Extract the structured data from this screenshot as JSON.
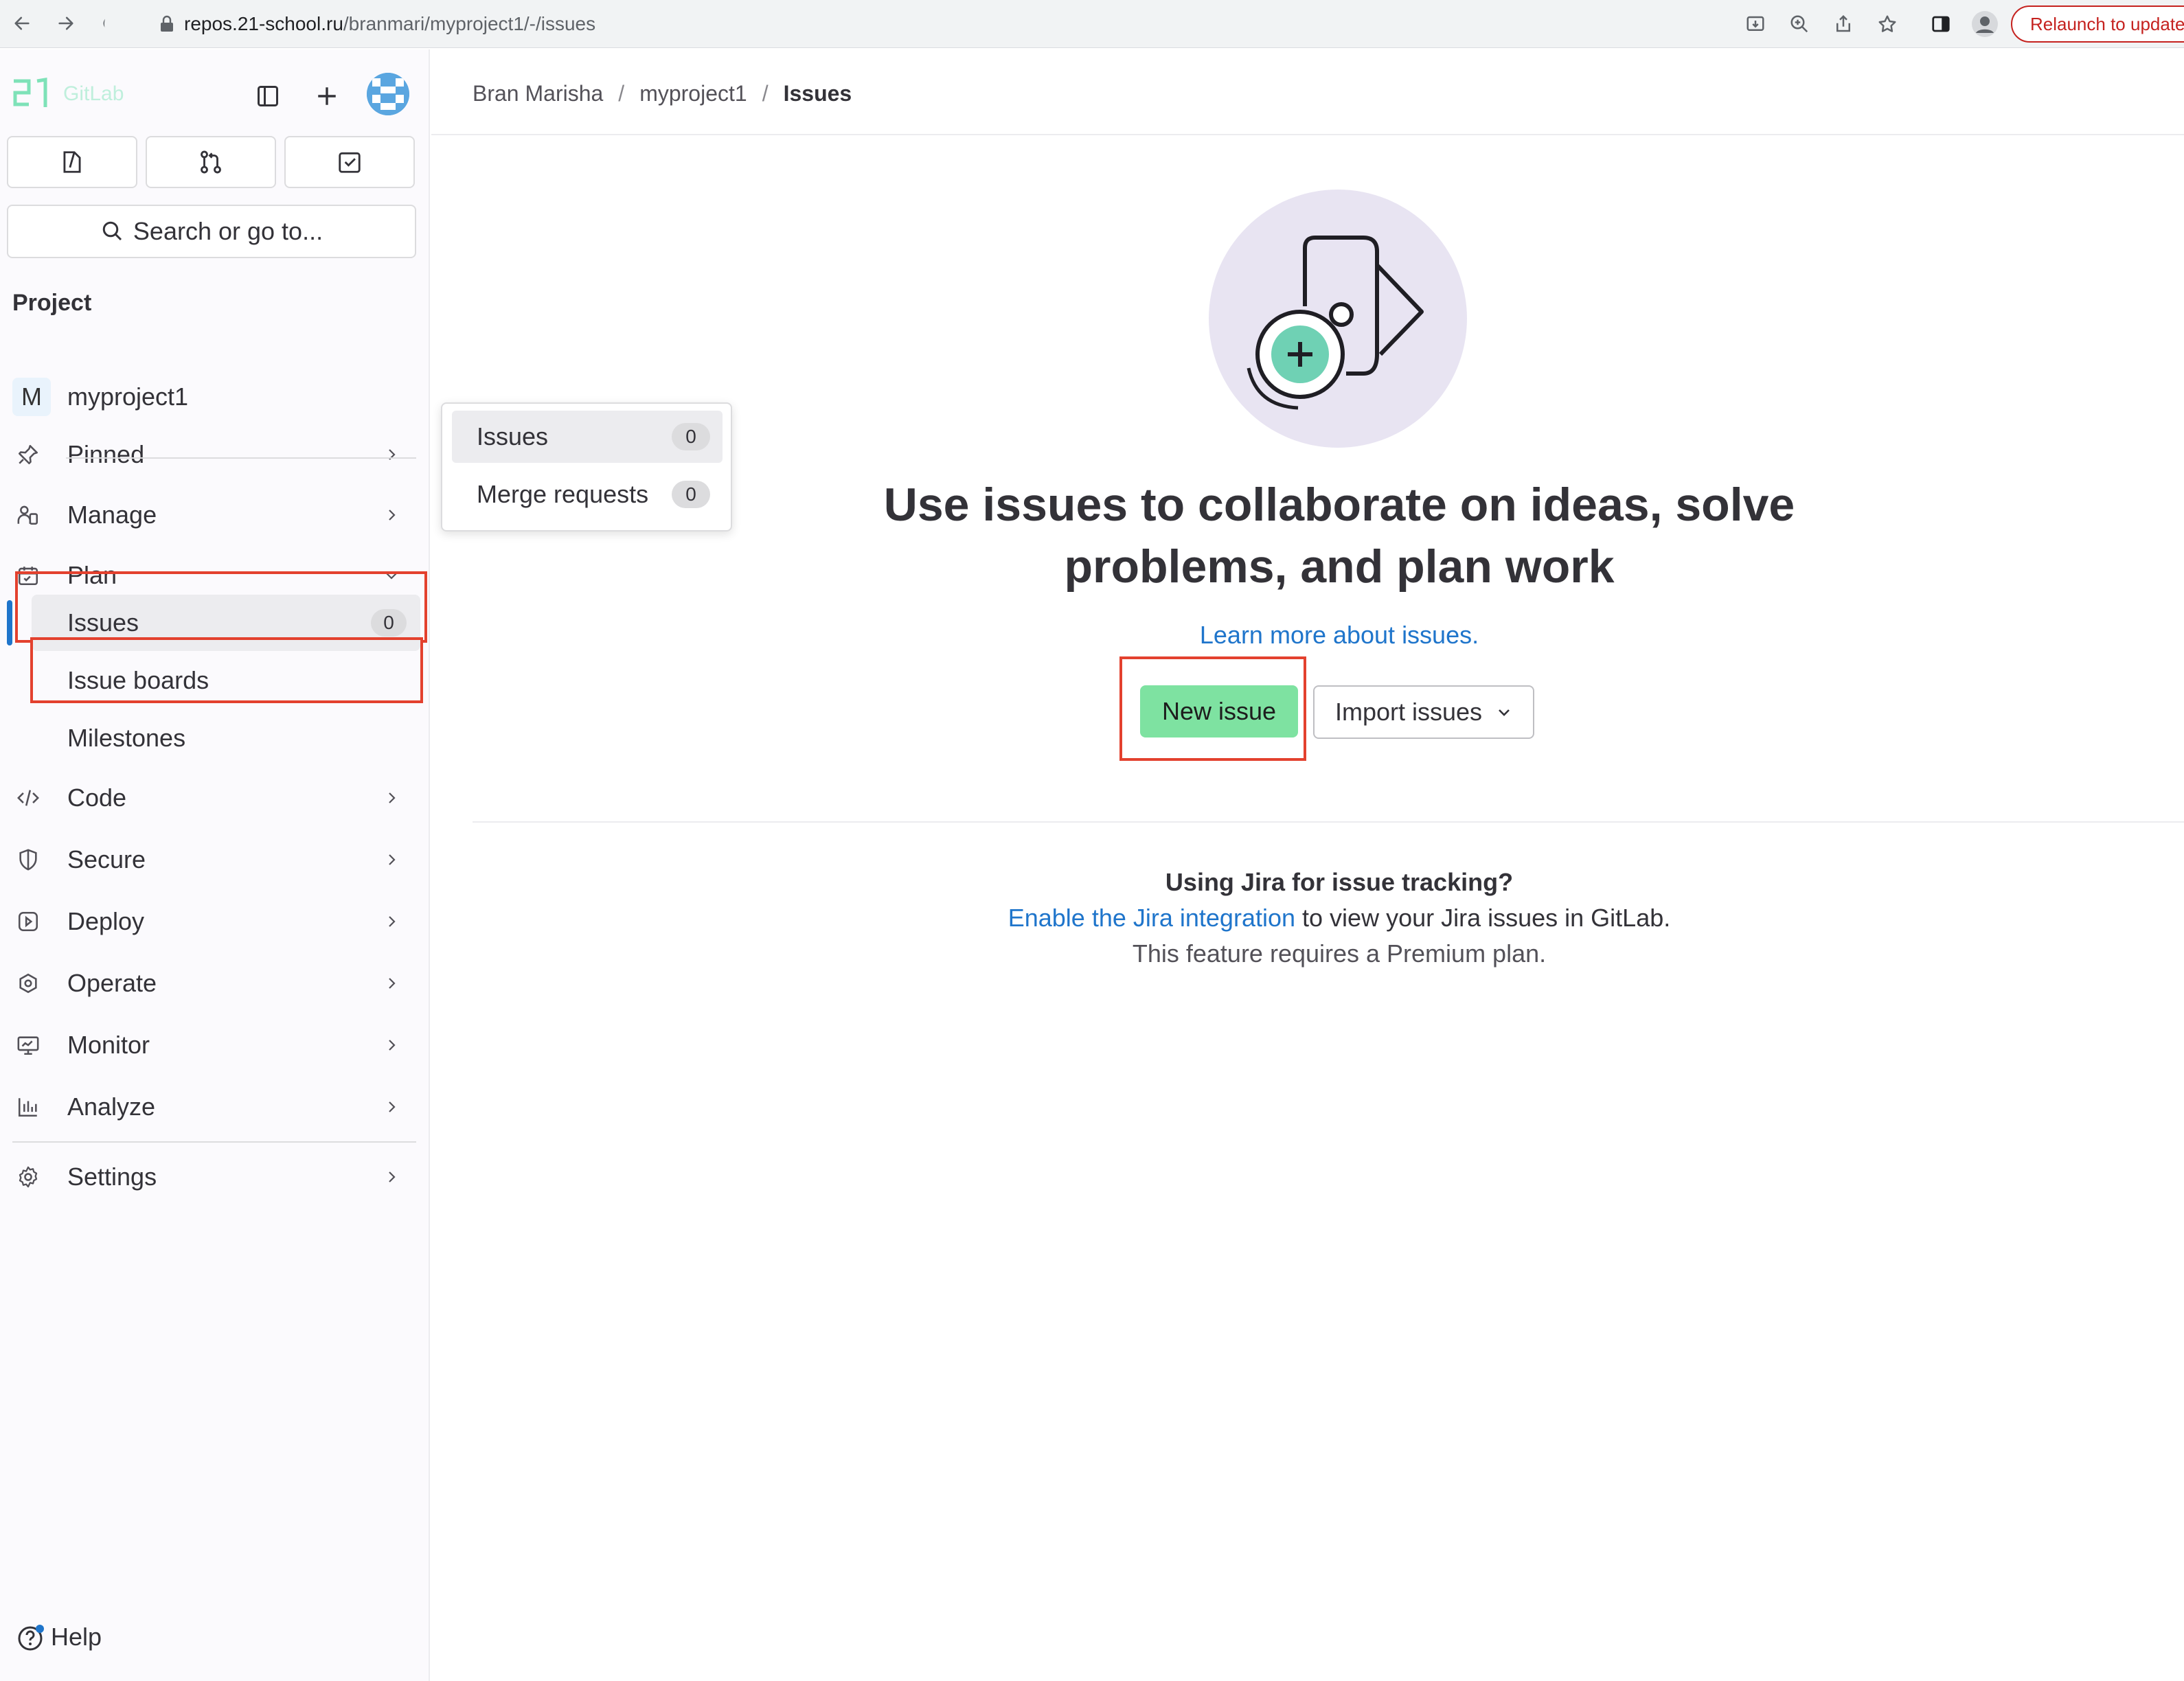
{
  "browser": {
    "url_host": "repos.21-school.ru",
    "url_path": "/branmari/myproject1/-/issues",
    "relaunch_label": "Relaunch to update"
  },
  "sidebar": {
    "logo_text": "GitLab",
    "search_label": "Search or go to...",
    "section_title": "Project",
    "project": {
      "letter": "M",
      "name": "myproject1"
    },
    "items": {
      "pinned": "Pinned",
      "manage": "Manage",
      "plan": "Plan",
      "code": "Code",
      "secure": "Secure",
      "deploy": "Deploy",
      "operate": "Operate",
      "monitor": "Monitor",
      "analyze": "Analyze",
      "settings": "Settings"
    },
    "plan_sub": {
      "issues": {
        "label": "Issues",
        "count": "0"
      },
      "issue_boards": "Issue boards",
      "milestones": "Milestones"
    },
    "help_label": "Help"
  },
  "flyout": {
    "issues": {
      "label": "Issues",
      "count": "0"
    },
    "merge_requests": {
      "label": "Merge requests",
      "count": "0"
    }
  },
  "breadcrumb": {
    "user": "Bran Marisha",
    "project": "myproject1",
    "current": "Issues",
    "separator": "/"
  },
  "empty_state": {
    "title_line1": "Use issues to collaborate on ideas, solve",
    "title_line2": "problems, and plan work",
    "learn_more": "Learn more about issues.",
    "new_issue": "New issue",
    "import_issues": "Import issues"
  },
  "jira": {
    "title": "Using Jira for issue tracking?",
    "link": "Enable the Jira integration",
    "text": " to view your Jira issues in GitLab.",
    "premium": "This feature requires a Premium plan."
  },
  "colors": {
    "accent_blue": "#1f75cb",
    "new_issue_green": "#7ee2a1",
    "highlight_red": "#e3412e",
    "illustration_bg": "#e8e4f2"
  }
}
